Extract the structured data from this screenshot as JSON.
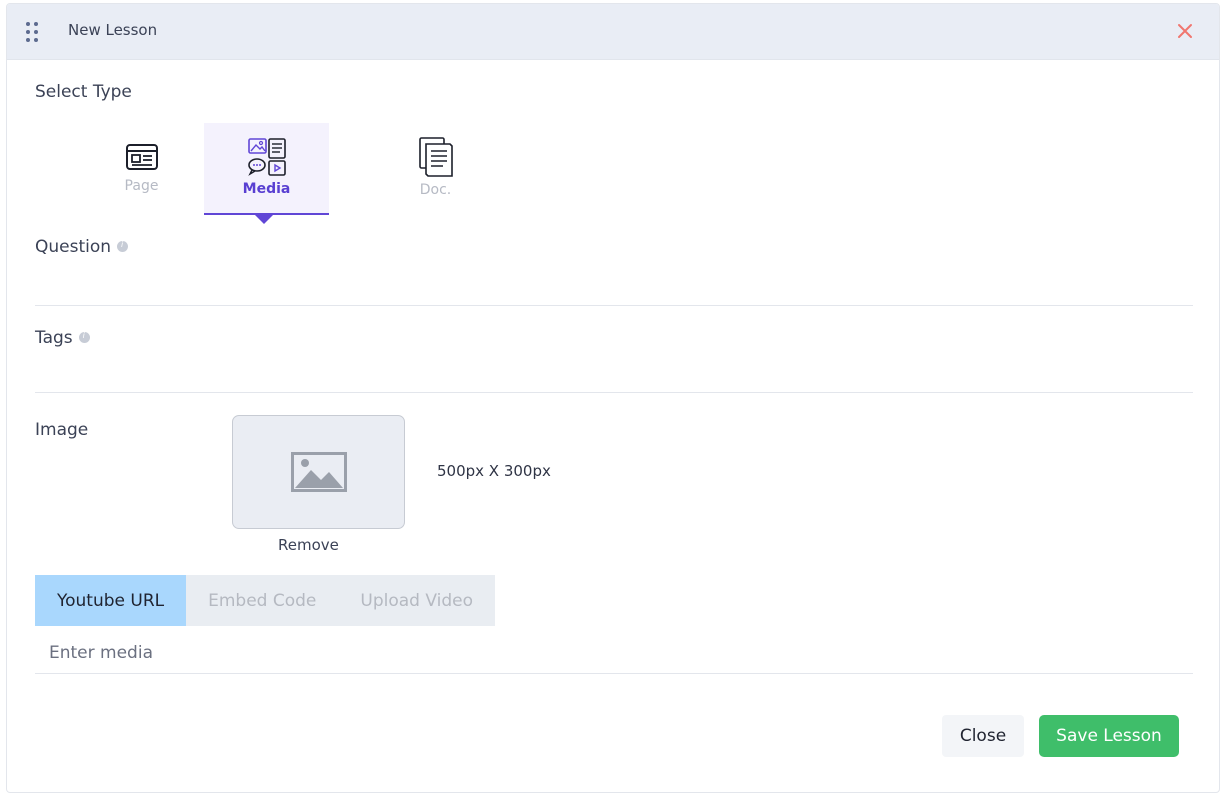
{
  "header": {
    "title": "New Lesson",
    "drag_icon": "drag-handle-icon",
    "close_icon": "close-icon",
    "close_color": "#f0766f"
  },
  "select_type": {
    "label": "Select Type",
    "options": [
      {
        "label": "Page",
        "icon": "page-layout-icon",
        "active": false
      },
      {
        "label": "Media",
        "icon": "media-gallery-icon",
        "active": true
      },
      {
        "label": "Doc.",
        "icon": "document-icon",
        "active": false
      }
    ]
  },
  "question": {
    "label": "Question",
    "info_icon": "info-icon"
  },
  "tags": {
    "label": "Tags",
    "info_icon": "info-icon"
  },
  "image": {
    "label": "Image",
    "size_hint": "500px X 300px",
    "remove_label": "Remove",
    "placeholder_icon": "image-placeholder-icon"
  },
  "media_tabs": [
    {
      "label": "Youtube URL",
      "active": true
    },
    {
      "label": "Embed Code",
      "active": false
    },
    {
      "label": "Upload Video",
      "active": false
    }
  ],
  "media_input": {
    "placeholder": "Enter media",
    "value": ""
  },
  "footer": {
    "close_label": "Close",
    "save_label": "Save Lesson"
  },
  "colors": {
    "accent": "#6046d6",
    "save_green": "#3fbe6a",
    "tab_active": "#a9d7fd",
    "header_bg": "#e9edf5"
  }
}
